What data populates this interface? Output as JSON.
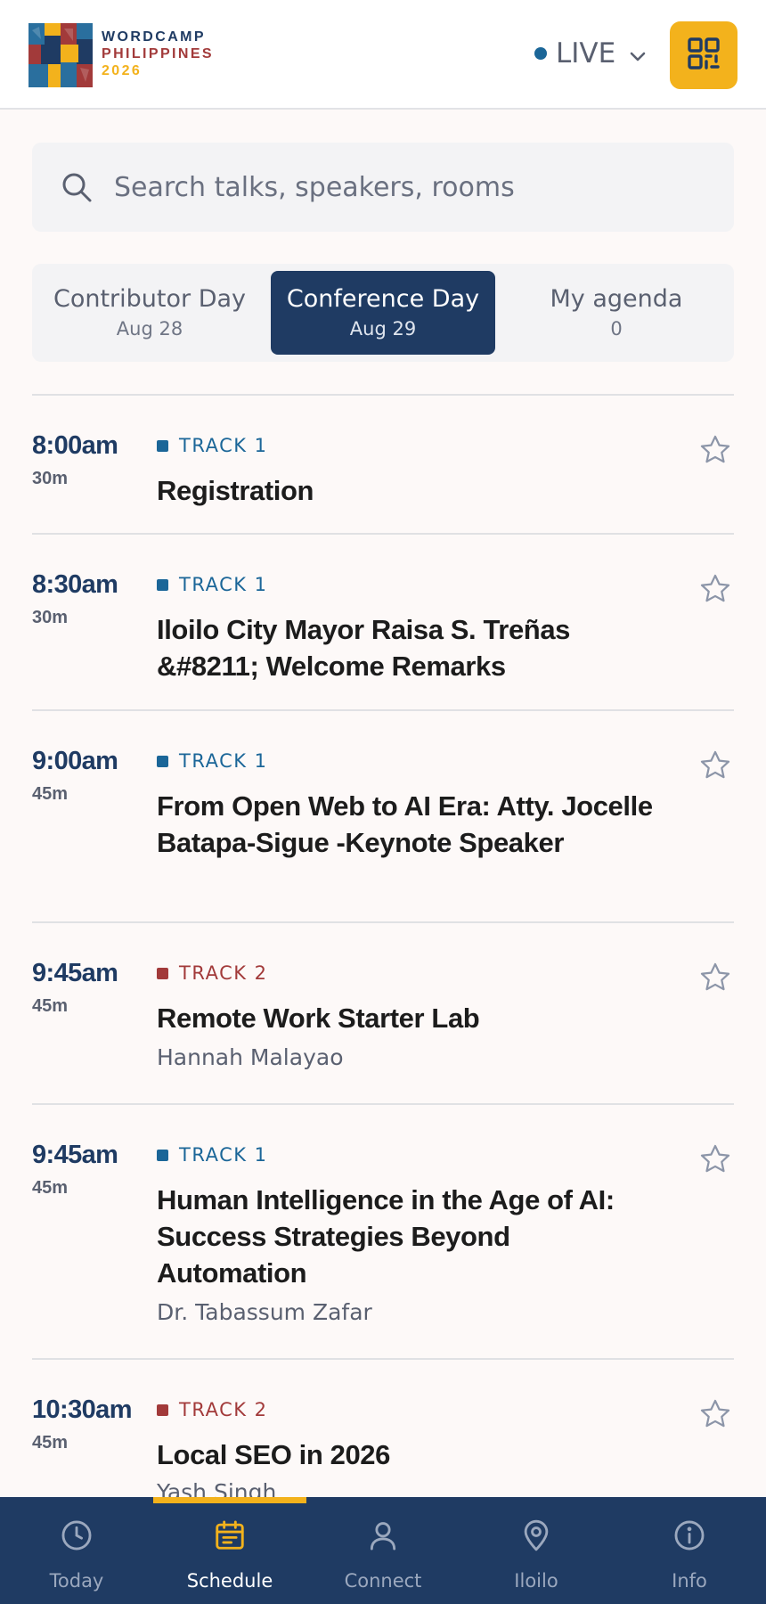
{
  "header": {
    "logo": {
      "line1": "WORDCAMP",
      "line2": "PHILIPPINES",
      "line3": "2026"
    },
    "live_label": "LIVE",
    "qr_icon": "qr-code-icon"
  },
  "search": {
    "placeholder": "Search talks, speakers, rooms"
  },
  "tabs": [
    {
      "label": "Contributor Day",
      "sub": "Aug 28",
      "active": false
    },
    {
      "label": "Conference Day",
      "sub": "Aug 29",
      "active": true
    },
    {
      "label": "My agenda",
      "sub": "0",
      "active": false
    }
  ],
  "colors": {
    "primary": "#1f3b63",
    "accent": "#f3b21c",
    "track1": "#1b6698",
    "track2": "#a23a3a"
  },
  "sessions": [
    {
      "time": "8:00am",
      "duration": "30m",
      "track": "TRACK 1",
      "title": "Registration",
      "speaker": ""
    },
    {
      "time": "8:30am",
      "duration": "30m",
      "track": "TRACK 1",
      "title": "Iloilo City Mayor Raisa S. Treñas &#8211; Welcome Remarks",
      "speaker": ""
    },
    {
      "time": "9:00am",
      "duration": "45m",
      "track": "TRACK 1",
      "title": "From Open Web to AI Era: Atty. Jocelle Batapa-Sigue -Keynote Speaker",
      "speaker": ""
    },
    {
      "time": "9:45am",
      "duration": "45m",
      "track": "TRACK 2",
      "title": "Remote Work Starter Lab",
      "speaker": "Hannah Malayao"
    },
    {
      "time": "9:45am",
      "duration": "45m",
      "track": "TRACK 1",
      "title": "Human Intelligence in the Age of AI: Success Strategies Beyond Automation",
      "speaker": "Dr. Tabassum Zafar"
    },
    {
      "time": "10:30am",
      "duration": "45m",
      "track": "TRACK 2",
      "title": "Local SEO in 2026",
      "speaker": "Yash Singh"
    }
  ],
  "bottom_nav": [
    {
      "label": "Today",
      "icon": "clock-icon",
      "active": false
    },
    {
      "label": "Schedule",
      "icon": "calendar-icon",
      "active": true
    },
    {
      "label": "Connect",
      "icon": "person-icon",
      "active": false
    },
    {
      "label": "Iloilo",
      "icon": "map-pin-icon",
      "active": false
    },
    {
      "label": "Info",
      "icon": "info-icon",
      "active": false
    }
  ]
}
